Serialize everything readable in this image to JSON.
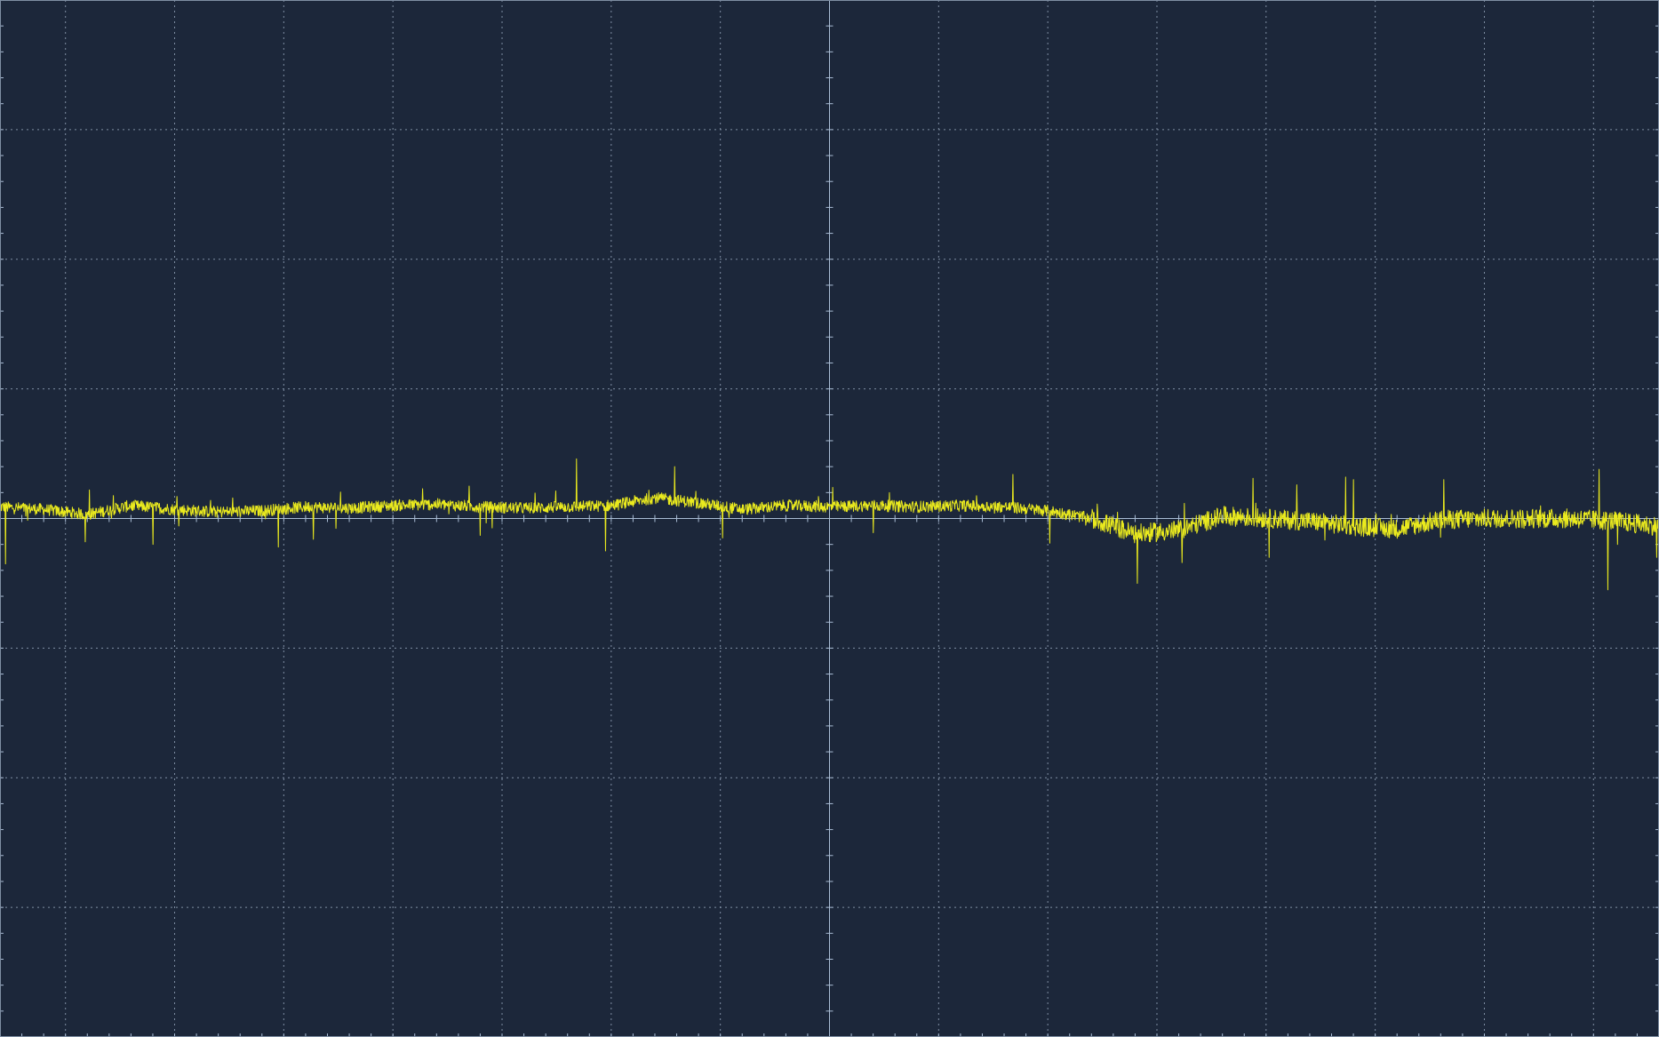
{
  "colors": {
    "background": "#1c273a",
    "grid": "#7f8ea3",
    "axis": "#a9bcd4",
    "trace": "#eaea1e"
  },
  "chart_data": {
    "type": "line",
    "title": "",
    "xlabel": "",
    "ylabel": "",
    "grid": true,
    "divisions": {
      "x": 15.2,
      "y": 8
    },
    "center_axes": true,
    "xlim": [
      -7.6,
      7.6
    ],
    "ylim": [
      -4,
      4
    ],
    "series": [
      {
        "name": "",
        "x": [
          -7.6,
          -7.2,
          -6.8,
          -6.4,
          -6.0,
          -5.6,
          -5.2,
          -4.8,
          -4.4,
          -4.0,
          -3.6,
          -3.2,
          -2.8,
          -2.4,
          -2.0,
          -1.6,
          -1.2,
          -0.8,
          -0.4,
          0.0,
          0.4,
          0.8,
          1.2,
          1.6,
          2.0,
          2.4,
          2.8,
          3.2,
          3.6,
          4.0,
          4.4,
          4.8,
          5.2,
          5.6,
          6.0,
          6.4,
          6.8,
          7.2,
          7.6
        ],
        "y": [
          0.09,
          0.07,
          0.03,
          0.1,
          0.07,
          0.05,
          0.06,
          0.09,
          0.08,
          0.1,
          0.11,
          0.09,
          0.08,
          0.09,
          0.1,
          0.16,
          0.12,
          0.07,
          0.1,
          0.09,
          0.1,
          0.09,
          0.1,
          0.09,
          0.06,
          0.0,
          -0.12,
          -0.09,
          0.02,
          0.0,
          -0.02,
          -0.06,
          -0.08,
          -0.01,
          0.0,
          0.0,
          0.0,
          -0.02,
          -0.06
        ]
      }
    ],
    "spikes": [
      {
        "x": -7.55,
        "y": -0.35
      },
      {
        "x": -6.78,
        "y": 0.22
      },
      {
        "x": -6.82,
        "y": -0.18
      },
      {
        "x": -6.2,
        "y": -0.2
      },
      {
        "x": -5.98,
        "y": 0.17
      },
      {
        "x": -5.67,
        "y": 0.14
      },
      {
        "x": -5.05,
        "y": -0.22
      },
      {
        "x": -4.73,
        "y": -0.16
      },
      {
        "x": -3.73,
        "y": 0.23
      },
      {
        "x": -3.3,
        "y": 0.25
      },
      {
        "x": -3.2,
        "y": -0.13
      },
      {
        "x": -2.32,
        "y": 0.46
      },
      {
        "x": -2.05,
        "y": -0.25
      },
      {
        "x": -1.42,
        "y": 0.4
      },
      {
        "x": -0.98,
        "y": -0.15
      },
      {
        "x": -0.1,
        "y": 0.17
      },
      {
        "x": 0.03,
        "y": 0.24
      },
      {
        "x": 0.4,
        "y": -0.11
      },
      {
        "x": 1.68,
        "y": 0.34
      },
      {
        "x": 2.02,
        "y": -0.19
      },
      {
        "x": 2.82,
        "y": -0.5
      },
      {
        "x": 3.23,
        "y": -0.34
      },
      {
        "x": 3.88,
        "y": 0.31
      },
      {
        "x": 4.03,
        "y": -0.3
      },
      {
        "x": 4.28,
        "y": 0.26
      },
      {
        "x": 4.73,
        "y": 0.32
      },
      {
        "x": 4.8,
        "y": 0.3
      },
      {
        "x": 5.63,
        "y": 0.3
      },
      {
        "x": 7.05,
        "y": 0.38
      },
      {
        "x": 7.13,
        "y": -0.55
      },
      {
        "x": 7.22,
        "y": -0.2
      },
      {
        "x": 7.58,
        "y": -0.3
      }
    ]
  }
}
